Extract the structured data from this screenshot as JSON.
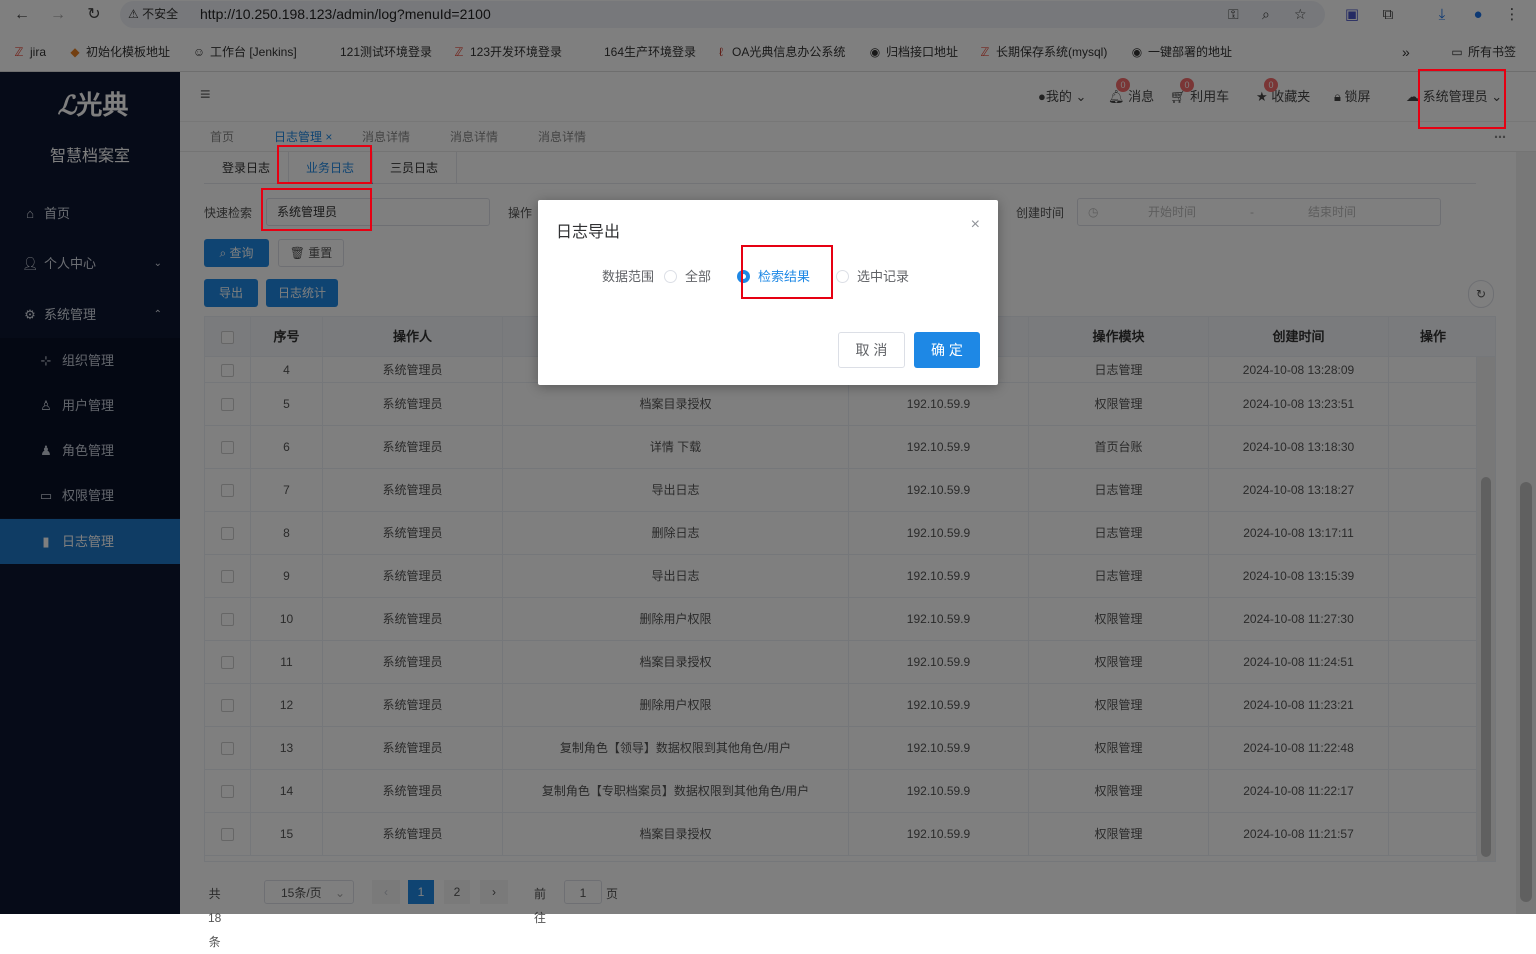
{
  "browser": {
    "secure_label": "不安全",
    "url": "http://10.250.198.123/admin/log?menuId=2100",
    "bookmarks": [
      "jira",
      "初始化模板地址",
      "工作台 [Jenkins]",
      "121测试环境登录",
      "123开发环境登录",
      "164生产环境登录",
      "OA光典信息办公系统",
      "归档接口地址",
      "长期保存系统(mysql)",
      "一键部署的地址"
    ],
    "all_bookmarks": "所有书签"
  },
  "sidebar": {
    "logo": "光典",
    "subtitle": "智慧档案室",
    "menu": [
      {
        "label": "首页",
        "icon": "home-icon"
      },
      {
        "label": "个人中心",
        "icon": "user-icon"
      },
      {
        "label": "系统管理",
        "icon": "gear-icon"
      }
    ],
    "submenu": [
      {
        "label": "组织管理",
        "icon": "org-icon"
      },
      {
        "label": "用户管理",
        "icon": "user-outline-icon"
      },
      {
        "label": "角色管理",
        "icon": "role-icon"
      },
      {
        "label": "权限管理",
        "icon": "folder-icon"
      },
      {
        "label": "日志管理",
        "icon": "chart-icon"
      }
    ]
  },
  "topbar": {
    "mine": "我的",
    "message": "消息",
    "message_count": "0",
    "cart": "利用车",
    "cart_count": "0",
    "favorites": "收藏夹",
    "fav_count": "0",
    "lock": "锁屏",
    "user": "系统管理员"
  },
  "tabs": [
    "首页",
    "日志管理",
    "消息详情",
    "消息详情",
    "消息详情"
  ],
  "subtabs": [
    "登录日志",
    "业务日志",
    "三员日志"
  ],
  "filters": {
    "quick_search_label": "快速检索",
    "quick_search_value": "系统管理员",
    "operator_label": "操作",
    "created_label": "创建时间",
    "start_placeholder": "开始时间",
    "end_placeholder": "结束时间",
    "range_sep": "-",
    "query": "查询",
    "reset": "重置",
    "export": "导出",
    "stats": "日志统计"
  },
  "table": {
    "headers": [
      "序号",
      "操作人",
      "操作模块",
      "创建时间",
      "操作"
    ],
    "rows": [
      {
        "no": "4",
        "user": "系统管理员",
        "action": "",
        "ip": "",
        "module": "日志管理",
        "time": "2024-10-08 13:28:09"
      },
      {
        "no": "5",
        "user": "系统管理员",
        "action": "档案目录授权",
        "ip": "192.10.59.9",
        "module": "权限管理",
        "time": "2024-10-08 13:23:51"
      },
      {
        "no": "6",
        "user": "系统管理员",
        "action": "详情 下载",
        "ip": "192.10.59.9",
        "module": "首页台账",
        "time": "2024-10-08 13:18:30"
      },
      {
        "no": "7",
        "user": "系统管理员",
        "action": "导出日志",
        "ip": "192.10.59.9",
        "module": "日志管理",
        "time": "2024-10-08 13:18:27"
      },
      {
        "no": "8",
        "user": "系统管理员",
        "action": "删除日志",
        "ip": "192.10.59.9",
        "module": "日志管理",
        "time": "2024-10-08 13:17:11"
      },
      {
        "no": "9",
        "user": "系统管理员",
        "action": "导出日志",
        "ip": "192.10.59.9",
        "module": "日志管理",
        "time": "2024-10-08 13:15:39"
      },
      {
        "no": "10",
        "user": "系统管理员",
        "action": "删除用户权限",
        "ip": "192.10.59.9",
        "module": "权限管理",
        "time": "2024-10-08 11:27:30"
      },
      {
        "no": "11",
        "user": "系统管理员",
        "action": "档案目录授权",
        "ip": "192.10.59.9",
        "module": "权限管理",
        "time": "2024-10-08 11:24:51"
      },
      {
        "no": "12",
        "user": "系统管理员",
        "action": "删除用户权限",
        "ip": "192.10.59.9",
        "module": "权限管理",
        "time": "2024-10-08 11:23:21"
      },
      {
        "no": "13",
        "user": "系统管理员",
        "action": "复制角色【领导】数据权限到其他角色/用户",
        "ip": "192.10.59.9",
        "module": "权限管理",
        "time": "2024-10-08 11:22:48"
      },
      {
        "no": "14",
        "user": "系统管理员",
        "action": "复制角色【专职档案员】数据权限到其他角色/用户",
        "ip": "192.10.59.9",
        "module": "权限管理",
        "time": "2024-10-08 11:22:17"
      },
      {
        "no": "15",
        "user": "系统管理员",
        "action": "档案目录授权",
        "ip": "192.10.59.9",
        "module": "权限管理",
        "time": "2024-10-08 11:21:57"
      }
    ]
  },
  "pager": {
    "total": "共 18 条",
    "page_size": "15条/页",
    "page1": "1",
    "page2": "2",
    "goto": "前往",
    "goto_value": "1",
    "page_unit": "页"
  },
  "modal": {
    "title": "日志导出",
    "range_label": "数据范围",
    "options": [
      "全部",
      "检索结果",
      "选中记录"
    ],
    "selected": "检索结果",
    "cancel": "取 消",
    "confirm": "确 定"
  },
  "colors": {
    "accent": "#1e88e5",
    "sidebar": "#0d1730",
    "highlight": "#e60012"
  }
}
